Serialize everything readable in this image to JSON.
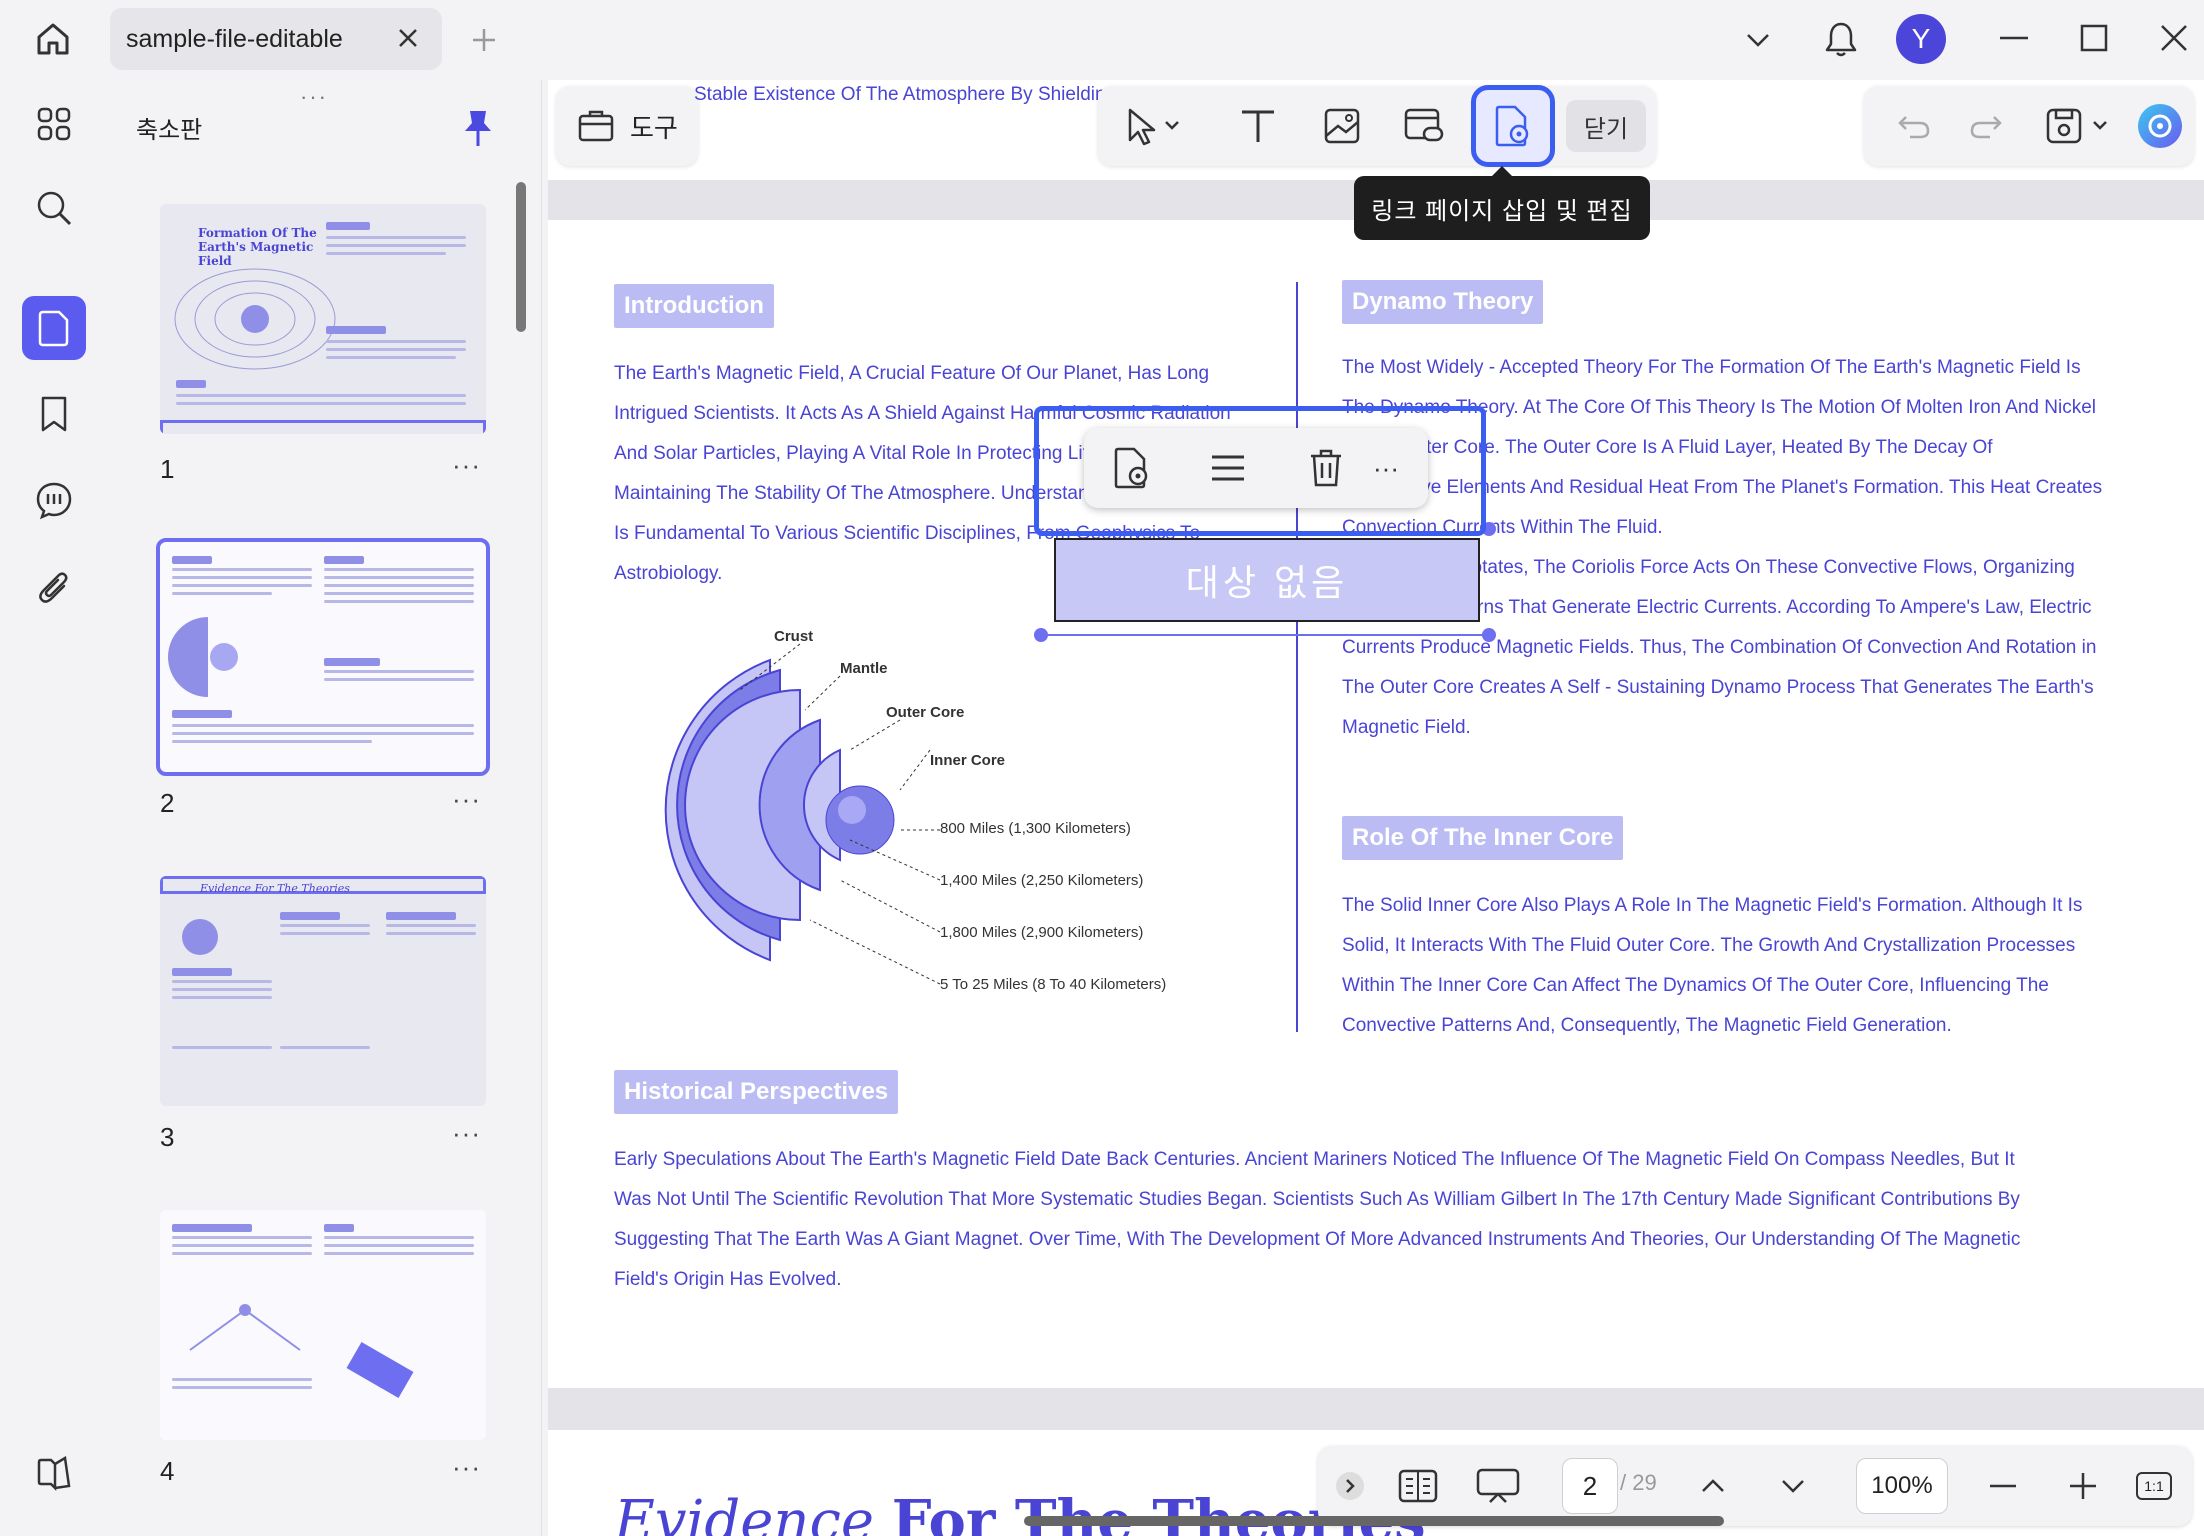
{
  "titlebar": {
    "tab_title": "sample-file-editable",
    "avatar_letter": "Y"
  },
  "sidebar": {
    "panel_title": "축소판",
    "thumbnails": [
      {
        "number": "1",
        "title": "Formation Of The Earth's Magnetic Field"
      },
      {
        "number": "2"
      },
      {
        "number": "3",
        "title": "Evidence For The Theories"
      },
      {
        "number": "4"
      }
    ],
    "more_label": "···"
  },
  "toolbar": {
    "tools_label": "도구",
    "doc_title_strip": "Stable Existence Of The Atmosphere By Shielding",
    "close_label": "닫기",
    "tooltip": "링크 페이지 삽입 및 편집"
  },
  "document": {
    "introduction": {
      "heading": "Introduction",
      "lines": [
        "The Earth's Magnetic Field, A Crucial Feature Of Our Planet, Has Long",
        "Intrigued Scientists. It Acts As A Shield Against Harmful Cosmic Radiation",
        "And Solar Particles, Playing A Vital Role In Protecting Life",
        "Maintaining The Stability Of The Atmosphere. Understanding",
        "Is Fundamental To Various Scientific Disciplines, From Geophysics To",
        "Astrobiology."
      ]
    },
    "dynamo": {
      "heading": "Dynamo Theory",
      "lines": [
        "The Most Widely - Accepted Theory For The Formation Of The Earth's Magnetic Field Is",
        "The Dynamo Theory. At The Core Of This Theory Is The Motion Of Molten Iron And Nickel",
        "In The Outer Core. The Outer Core Is A Fluid Layer, Heated By The Decay Of",
        "Radioactive Elements And Residual Heat From The Planet's Formation. This Heat Creates",
        "Convection Currents Within The Fluid.",
        "As The Earth Rotates, The Coriolis Force Acts On These Convective Flows, Organizing",
        "Them Into Patterns That Generate Electric Currents. According To Ampere's Law, Electric",
        "Currents Produce Magnetic Fields. Thus, The Combination Of Convection And Rotation in",
        "The Outer Core Creates A Self - Sustaining Dynamo Process That Generates The Earth's",
        "Magnetic Field."
      ]
    },
    "inner_core": {
      "heading": "Role Of The Inner Core",
      "lines": [
        "The Solid Inner Core Also Plays A Role In The Magnetic Field's Formation. Although It Is",
        "Solid, It Interacts With The Fluid Outer Core. The Growth And Crystallization Processes",
        "Within The Inner Core Can Affect The Dynamics Of The Outer Core, Influencing The",
        "Convective Patterns And, Consequently, The Magnetic Field Generation."
      ]
    },
    "historical": {
      "heading": "Historical Perspectives",
      "lines": [
        "Early Speculations About The Earth's Magnetic Field Date Back Centuries. Ancient Mariners Noticed The Influence Of The Magnetic Field On Compass Needles, But It",
        "Was Not Until The Scientific Revolution That More Systematic Studies Began. Scientists Such As William Gilbert In The 17th Century Made Significant Contributions By",
        "Suggesting That The Earth Was A Giant Magnet. Over Time, With The Development Of More Advanced Instruments And Theories, Our Understanding Of The Magnetic",
        "Field's Origin Has Evolved."
      ]
    },
    "diagram": {
      "crust": "Crust",
      "mantle": "Mantle",
      "outer_core": "Outer Core",
      "inner_core": "Inner Core",
      "m1": "800 Miles (1,300 Kilometers)",
      "m2": "1,400 Miles (2,250 Kilometers)",
      "m3": "1,800 Miles (2,900 Kilometers)",
      "m4": "5 To 25 Miles (8 To 40 Kilometers)"
    },
    "link_box_text": "대상 없음",
    "page2_heading_italic": "Evidence",
    "page2_heading_bold": "For The Theories"
  },
  "bottom_nav": {
    "current_page": "2",
    "total_pages": "/ 29",
    "zoom": "100%",
    "fit_label": "1:1"
  },
  "colors": {
    "accent": "#5b5bf0",
    "text_blue": "#4a44d4",
    "highlight_outline": "#3b5ef0",
    "section_bg": "#bcbcf4"
  }
}
